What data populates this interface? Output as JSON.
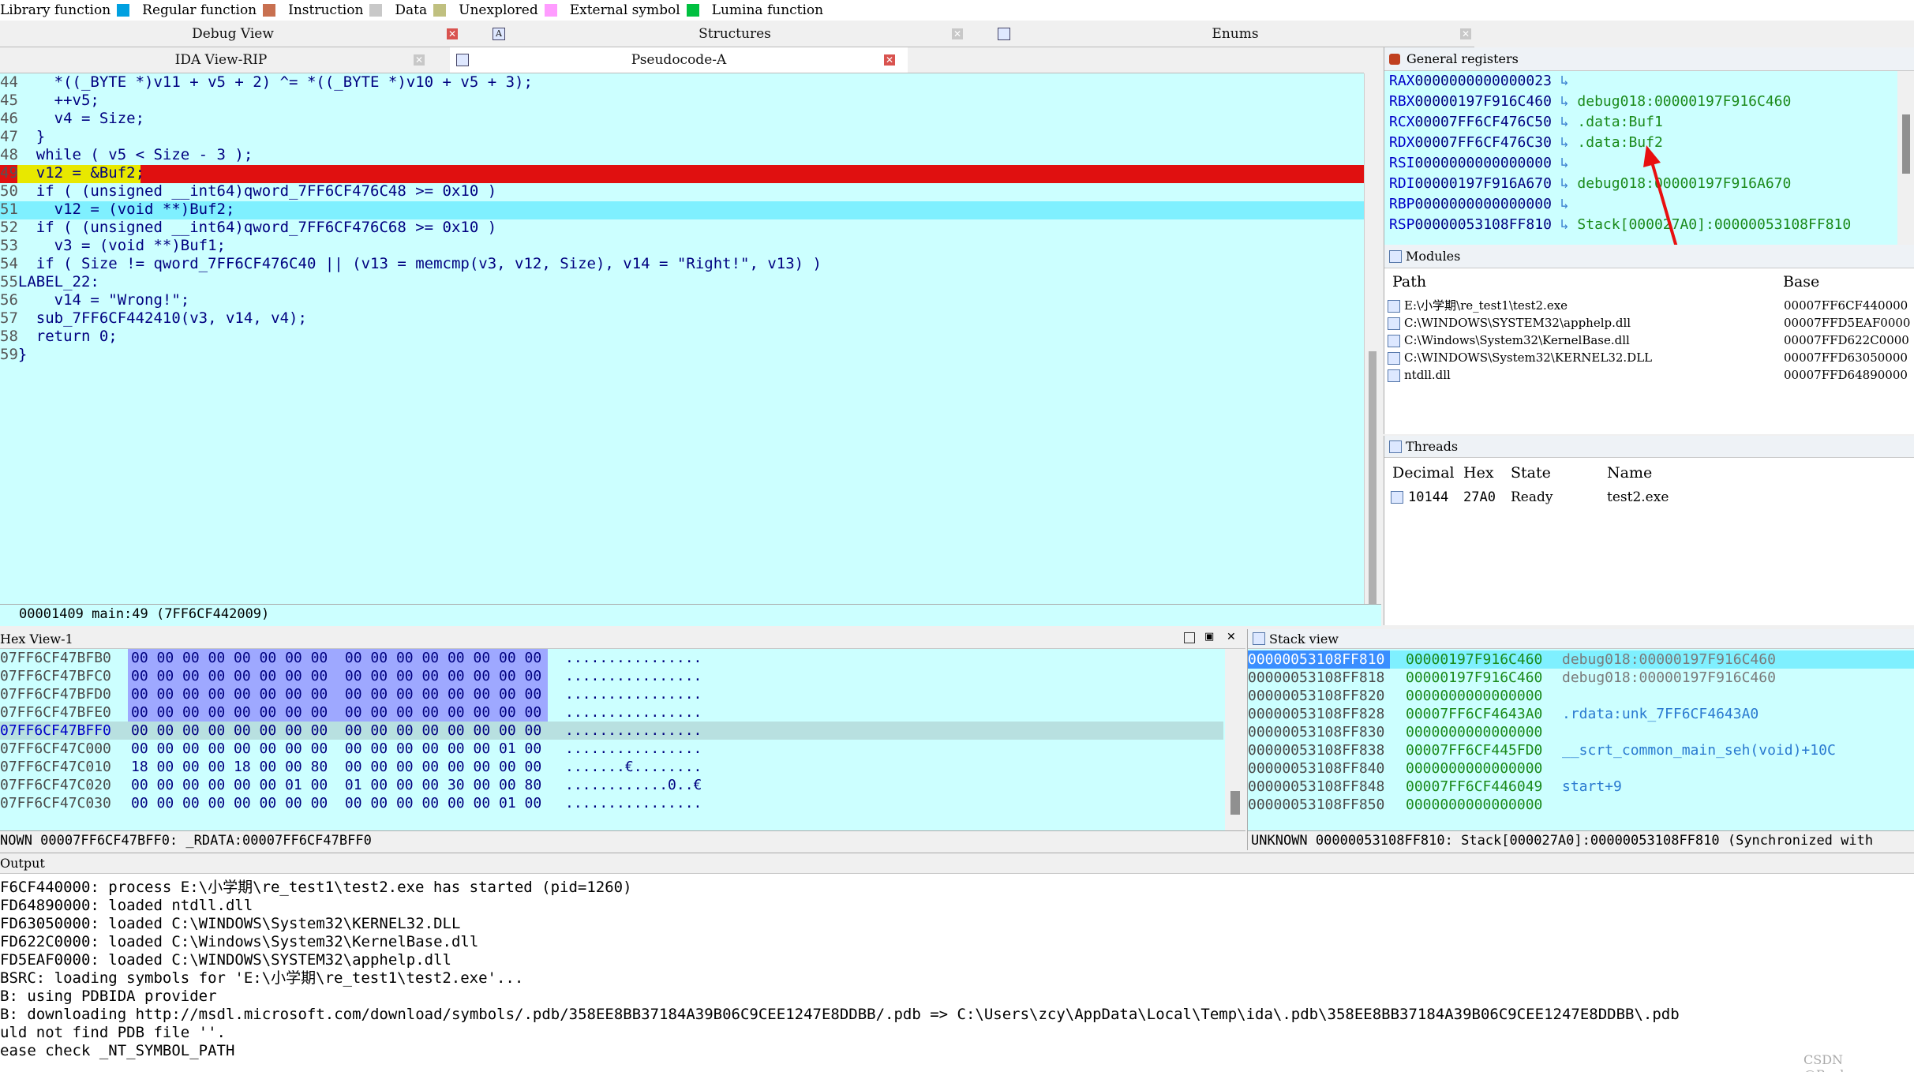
{
  "legend": [
    {
      "label": "Library function",
      "color": "#00a0e0"
    },
    {
      "label": "Regular function",
      "color": "#c87050"
    },
    {
      "label": "Instruction",
      "color": "#c8c8c8"
    },
    {
      "label": "Data",
      "color": "#c0c080"
    },
    {
      "label": "Unexplored",
      "color": "#ff9cff"
    },
    {
      "label": "External symbol",
      "color": "#00c040"
    },
    {
      "label": "Lumina function",
      "color": ""
    }
  ],
  "tabs_top": {
    "debug_view": "Debug View",
    "structures": "Structures",
    "enums": "Enums"
  },
  "tabs_second": {
    "ida_view": "IDA View-RIP",
    "pseudocode": "Pseudocode-A"
  },
  "code_lines": [
    {
      "num": "44",
      "text": "    *((_BYTE *)v11 + v5 + 2) ^= *((_BYTE *)v10 + v5 + 3);"
    },
    {
      "num": "45",
      "text": "    ++v5;"
    },
    {
      "num": "46",
      "text": "    v4 = Size;"
    },
    {
      "num": "47",
      "text": "  }"
    },
    {
      "num": "48",
      "text": "  while ( v5 < Size - 3 );"
    },
    {
      "num": "49",
      "text": "  v12 = &Buf2;"
    },
    {
      "num": "50",
      "text": "  if ( (unsigned __int64)qword_7FF6CF476C48 >= 0x10 )"
    },
    {
      "num": "51",
      "text": "    v12 = (void **)Buf2;"
    },
    {
      "num": "52",
      "text": "  if ( (unsigned __int64)qword_7FF6CF476C68 >= 0x10 )"
    },
    {
      "num": "53",
      "text": "    v3 = (void **)Buf1;"
    },
    {
      "num": "54",
      "text": "  if ( Size != qword_7FF6CF476C40 || (v13 = memcmp(v3, v12, Size), v14 = \"Right!\", v13) )"
    },
    {
      "num": "55",
      "text": "LABEL_22:"
    },
    {
      "num": "56",
      "text": "    v14 = \"Wrong!\";"
    },
    {
      "num": "57",
      "text": "  sub_7FF6CF442410(v3, v14, v4);"
    },
    {
      "num": "58",
      "text": "  return 0;"
    },
    {
      "num": "59",
      "text": "}"
    }
  ],
  "code_status": "00001409 main:49 (7FF6CF442009)",
  "registers_title": "General registers",
  "registers": [
    {
      "name": "RAX",
      "value": "0000000000000023",
      "ref": ""
    },
    {
      "name": "RBX",
      "value": "00000197F916C460",
      "ref": "debug018:00000197F916C460"
    },
    {
      "name": "RCX",
      "value": "00007FF6CF476C50",
      "ref": ".data:Buf1"
    },
    {
      "name": "RDX",
      "value": "00007FF6CF476C30",
      "ref": ".data:Buf2"
    },
    {
      "name": "RSI",
      "value": "0000000000000000",
      "ref": ""
    },
    {
      "name": "RDI",
      "value": "00000197F916A670",
      "ref": "debug018:00000197F916A670"
    },
    {
      "name": "RBP",
      "value": "0000000000000000",
      "ref": ""
    },
    {
      "name": "RSP",
      "value": "00000053108FF810",
      "ref": "Stack[000027A0]:00000053108FF810"
    }
  ],
  "modules": {
    "title": "Modules",
    "col_path": "Path",
    "col_base": "Base",
    "rows": [
      {
        "path": "E:\\小学期\\re_test1\\test2.exe",
        "base": "00007FF6CF440000"
      },
      {
        "path": "C:\\WINDOWS\\SYSTEM32\\apphelp.dll",
        "base": "00007FFD5EAF0000"
      },
      {
        "path": "C:\\Windows\\System32\\KernelBase.dll",
        "base": "00007FFD622C0000"
      },
      {
        "path": "C:\\WINDOWS\\System32\\KERNEL32.DLL",
        "base": "00007FFD63050000"
      },
      {
        "path": "ntdll.dll",
        "base": "00007FFD64890000"
      }
    ]
  },
  "threads": {
    "title": "Threads",
    "col_decimal": "Decimal",
    "col_hex": "Hex",
    "col_state": "State",
    "col_name": "Name",
    "row": {
      "decimal": "10144",
      "hex": "27A0",
      "state": "Ready",
      "name": "test2.exe"
    }
  },
  "hex_title": "Hex View-1",
  "hex_rows": [
    {
      "addr": "07FF6CF47BFB0",
      "bytes": "00 00 00 00 00 00 00 00  00 00 00 00 00 00 00 00",
      "ascii": "................"
    },
    {
      "addr": "07FF6CF47BFC0",
      "bytes": "00 00 00 00 00 00 00 00  00 00 00 00 00 00 00 00",
      "ascii": "................"
    },
    {
      "addr": "07FF6CF47BFD0",
      "bytes": "00 00 00 00 00 00 00 00  00 00 00 00 00 00 00 00",
      "ascii": "................"
    },
    {
      "addr": "07FF6CF47BFE0",
      "bytes": "00 00 00 00 00 00 00 00  00 00 00 00 00 00 00 00",
      "ascii": "................"
    },
    {
      "addr": "07FF6CF47BFF0",
      "bytes": "00 00 00 00 00 00 00 00  00 00 00 00 00 00 00 00",
      "ascii": "................"
    },
    {
      "addr": "07FF6CF47C000",
      "bytes": "00 00 00 00 00 00 00 00  00 00 00 00 00 00 01 00",
      "ascii": "................"
    },
    {
      "addr": "07FF6CF47C010",
      "bytes": "18 00 00 00 18 00 00 80  00 00 00 00 00 00 00 00",
      "ascii": ".......€........"
    },
    {
      "addr": "07FF6CF47C020",
      "bytes": "00 00 00 00 00 00 01 00  01 00 00 00 30 00 00 80",
      "ascii": "............0..€"
    },
    {
      "addr": "07FF6CF47C030",
      "bytes": "00 00 00 00 00 00 00 00  00 00 00 00 00 00 01 00",
      "ascii": "................"
    }
  ],
  "hex_status": "NOWN 00007FF6CF47BFF0: _RDATA:00007FF6CF47BFF0",
  "stack_title": "Stack view",
  "stack_rows": [
    {
      "addr": "00000053108FF810",
      "value": "00000197F916C460",
      "ref": "debug018:00000197F916C460"
    },
    {
      "addr": "00000053108FF818",
      "value": "00000197F916C460",
      "ref": "debug018:00000197F916C460"
    },
    {
      "addr": "00000053108FF820",
      "value": "0000000000000000",
      "ref": ""
    },
    {
      "addr": "00000053108FF828",
      "value": "00007FF6CF4643A0",
      "ref": ".rdata:unk_7FF6CF4643A0"
    },
    {
      "addr": "00000053108FF830",
      "value": "0000000000000000",
      "ref": ""
    },
    {
      "addr": "00000053108FF838",
      "value": "00007FF6CF445FD0",
      "ref": "__scrt_common_main_seh(void)+10C"
    },
    {
      "addr": "00000053108FF840",
      "value": "0000000000000000",
      "ref": ""
    },
    {
      "addr": "00000053108FF848",
      "value": "00007FF6CF446049",
      "ref": "start+9"
    },
    {
      "addr": "00000053108FF850",
      "value": "0000000000000000",
      "ref": ""
    }
  ],
  "stack_status": "UNKNOWN 00000053108FF810: Stack[000027A0]:00000053108FF810 (Synchronized with",
  "output_title": "Output",
  "output_lines": [
    "F6CF440000: process E:\\小学期\\re_test1\\test2.exe has started (pid=1260)",
    "FD64890000: loaded ntdll.dll",
    "FD63050000: loaded C:\\WINDOWS\\System32\\KERNEL32.DLL",
    "FD622C0000: loaded C:\\Windows\\System32\\KernelBase.dll",
    "FD5EAF0000: loaded C:\\WINDOWS\\SYSTEM32\\apphelp.dll",
    "BSRC: loading symbols for 'E:\\小学期\\re_test1\\test2.exe'...",
    "B: using PDBIDA provider",
    "B: downloading http://msdl.microsoft.com/download/symbols/.pdb/358EE8BB37184A39B06C9CEE1247E8DDBB/.pdb => C:\\Users\\zcy\\AppData\\Local\\Temp\\ida\\.pdb\\358EE8BB37184A39B06C9CEE1247E8DDBB\\.pdb",
    "uld not find PDB file ''.",
    "ease check _NT_SYMBOL_PATH"
  ],
  "watermark": "CSDN @Back~~~"
}
